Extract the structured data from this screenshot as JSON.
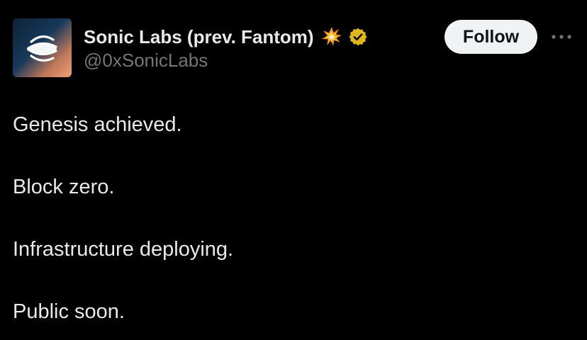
{
  "author": {
    "display_name": "Sonic Labs (prev. Fantom)",
    "handle": "@0xSonicLabs",
    "name_emoji": "collision-emoji",
    "verified_badge": "verified-badge-icon",
    "avatar_icon": "sonic-labs-logo"
  },
  "actions": {
    "follow_label": "Follow",
    "more_icon": "more-dots-icon"
  },
  "tweet": {
    "lines": [
      "Genesis achieved.",
      "Block zero.",
      "Infrastructure deploying.",
      "Public soon."
    ]
  },
  "colors": {
    "background": "#000000",
    "text_primary": "#e7e9ea",
    "text_secondary": "#71767b",
    "follow_button_bg": "#eff3f4",
    "follow_button_text": "#0f1419",
    "verified_badge": "#e2b719"
  }
}
